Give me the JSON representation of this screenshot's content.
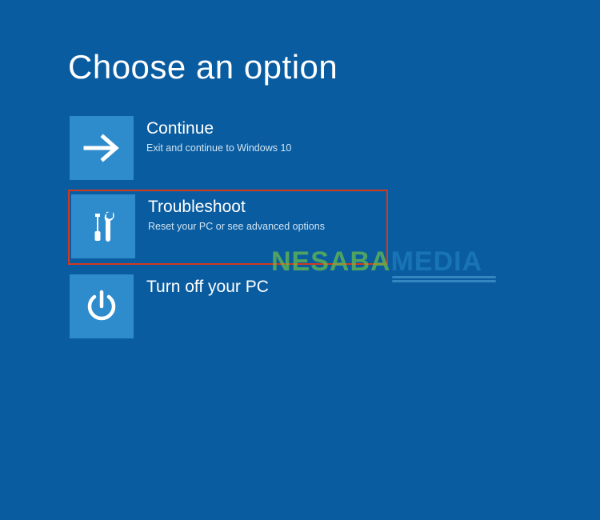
{
  "page": {
    "title": "Choose an option"
  },
  "options": {
    "continue": {
      "title": "Continue",
      "subtitle": "Exit and continue to Windows 10"
    },
    "troubleshoot": {
      "title": "Troubleshoot",
      "subtitle": "Reset your PC or see advanced options"
    },
    "turnoff": {
      "title": "Turn off your PC"
    }
  },
  "watermark": {
    "part1": "NESABA",
    "part2": "MEDIA"
  }
}
